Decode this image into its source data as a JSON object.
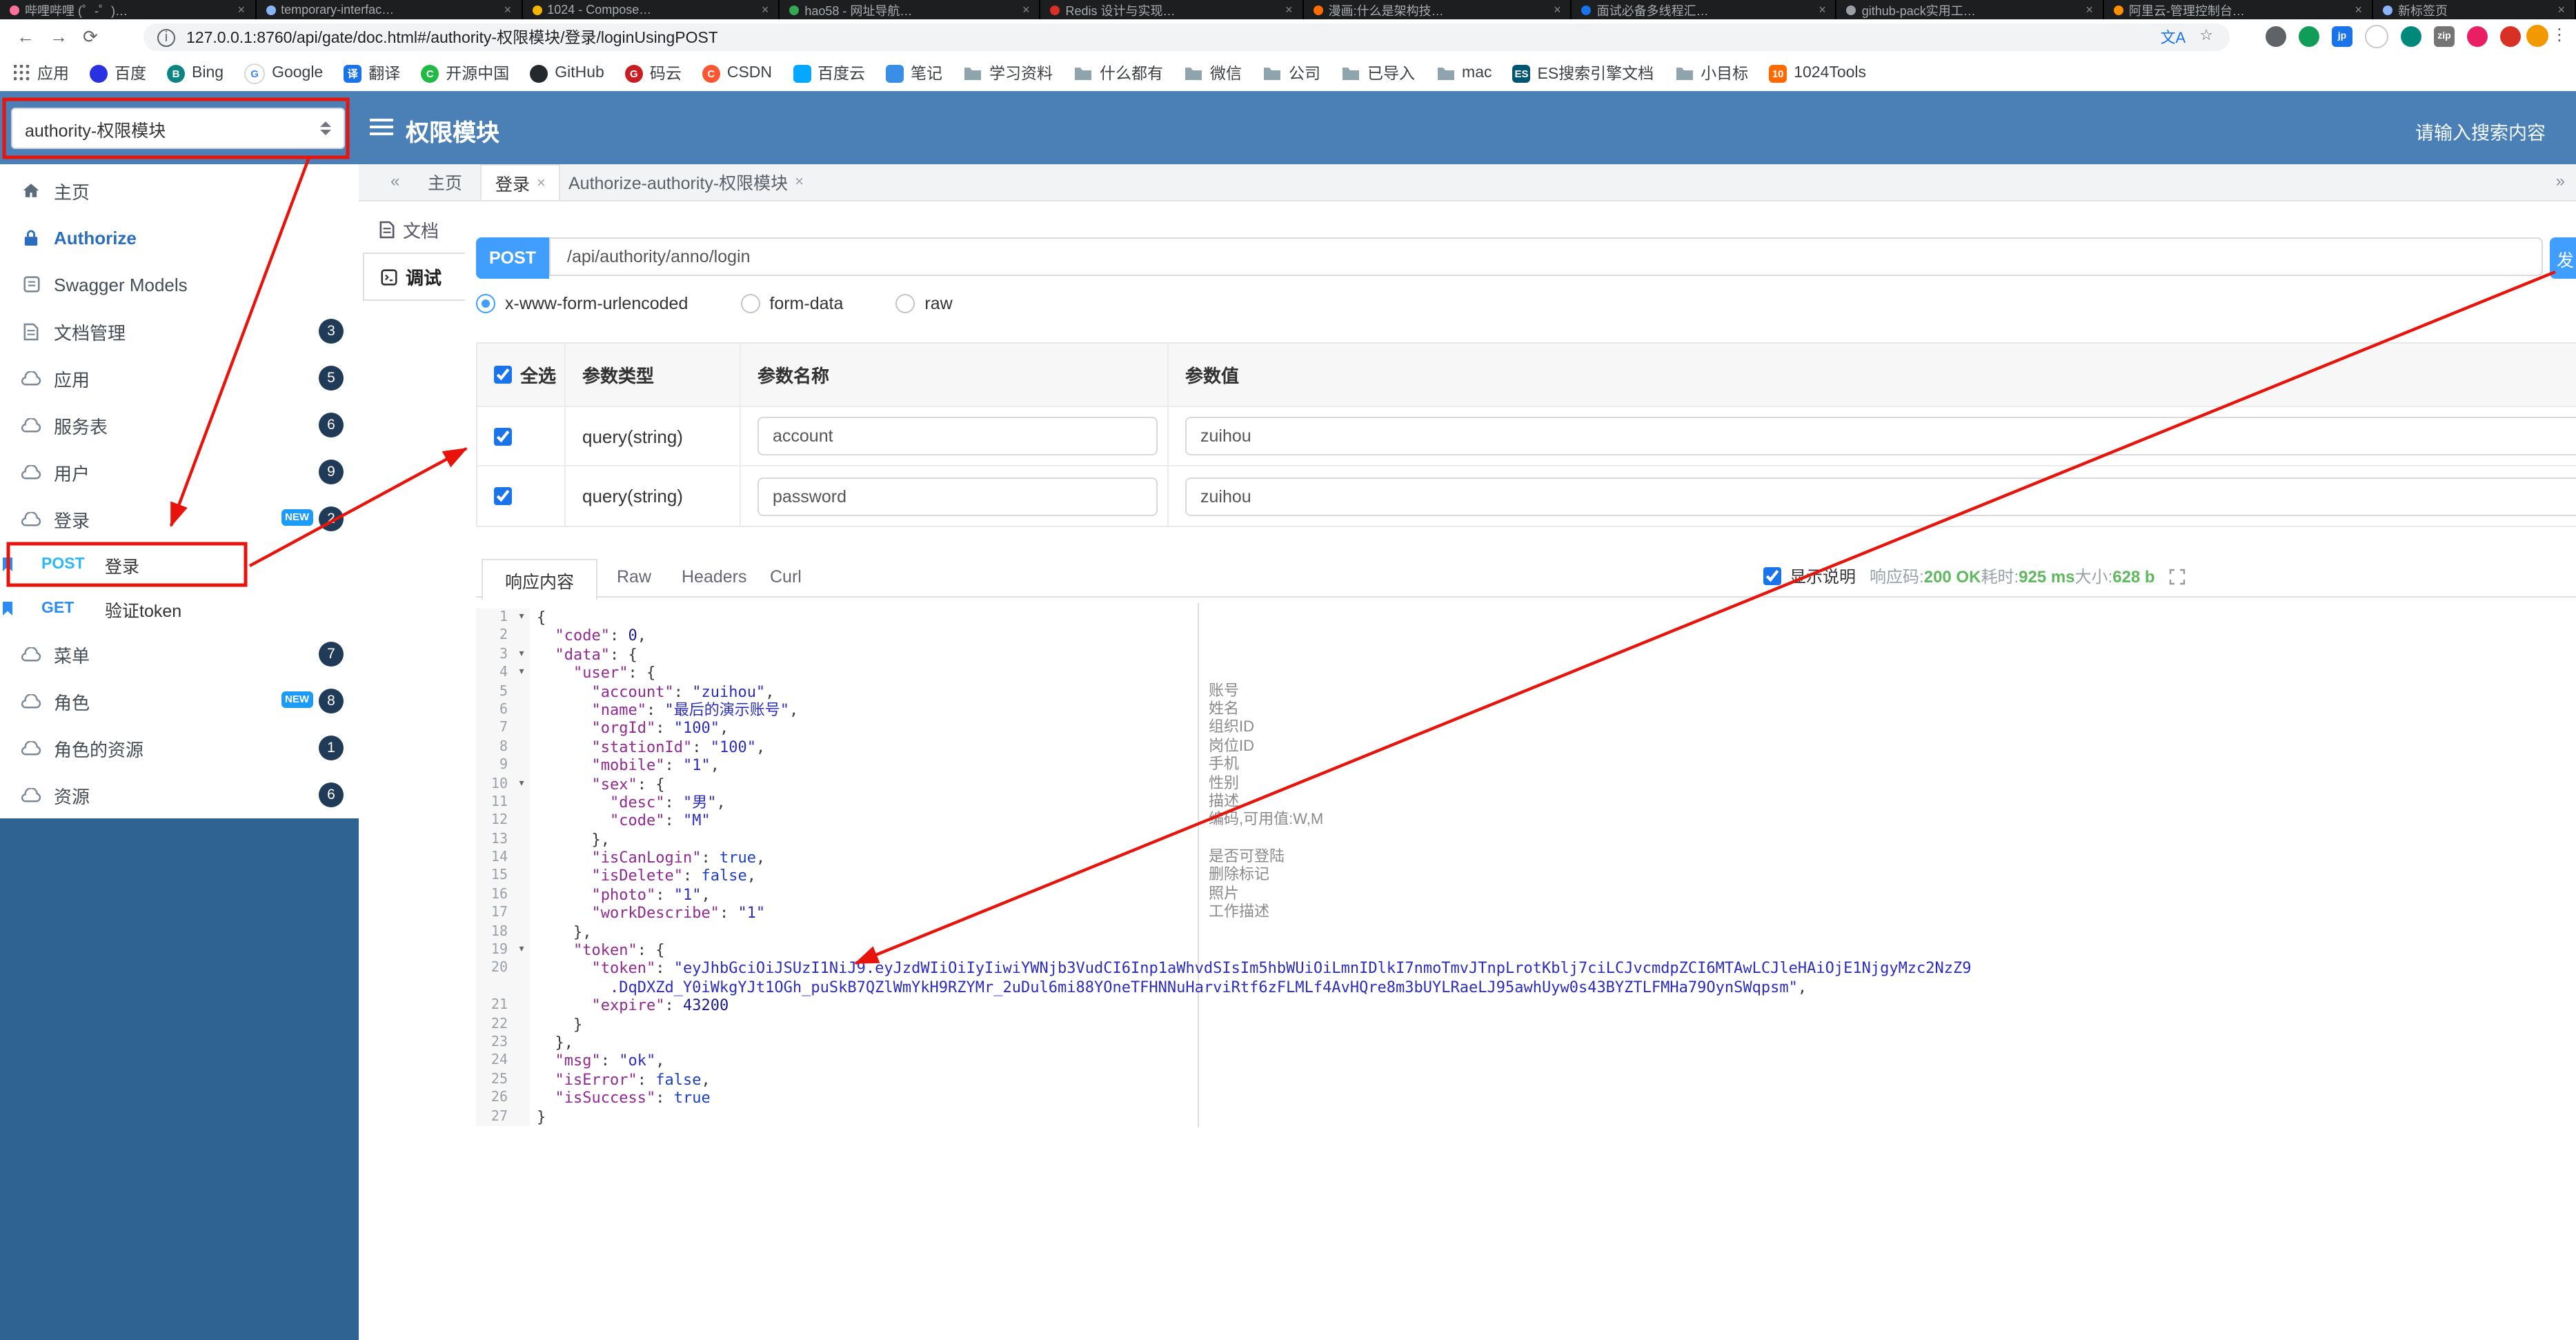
{
  "colors": {
    "accent": "#409EFF",
    "header_blue": "#4b80b6",
    "sidebar_bottom_blue": "#2f6391",
    "annotation_red": "#e8140c",
    "success_green": "#5eb95e",
    "post_method": "#2db7f5",
    "get_method": "#2d8cf0",
    "badge": "#1f3b57",
    "new_badge": "#1c9cf6"
  },
  "browser": {
    "tabs": [
      {
        "title": "哔哩哔哩 (゜-゜)…",
        "color": "#fb7299"
      },
      {
        "title": "temporary-interfac…",
        "color": "#8ab4f8"
      },
      {
        "title": "1024 - Compose…",
        "color": "#f4b400"
      },
      {
        "title": "hao58 - 网址导航…",
        "color": "#34a853"
      },
      {
        "title": "Redis 设计与实现…",
        "color": "#d93025"
      },
      {
        "title": "漫画:什么是架构技…",
        "color": "#ff6d00"
      },
      {
        "title": "面试必备多线程汇…",
        "color": "#1a73e8"
      },
      {
        "title": "github-pack实用工…",
        "color": "#9aa0a6"
      },
      {
        "title": "阿里云-管理控制台…",
        "color": "#ff8f00"
      },
      {
        "title": "新标签页",
        "color": "#8ab4f8"
      }
    ],
    "url": "127.0.0.1:8760/api/gate/doc.html#/authority-权限模块/登录/loginUsingPOST",
    "extensions": [
      {
        "shape": "circle",
        "color": "#5f6368",
        "letter": ""
      },
      {
        "shape": "circle",
        "color": "#0f9d58",
        "letter": ""
      },
      {
        "shape": "square",
        "color": "#1a73e8",
        "letter": "jp"
      },
      {
        "shape": "circle",
        "color": "#ffffff",
        "letter": "",
        "border": true
      },
      {
        "shape": "circle",
        "color": "#00897b",
        "letter": ""
      },
      {
        "shape": "square",
        "color": "#757575",
        "letter": "zip"
      },
      {
        "shape": "circle",
        "color": "#e91e63",
        "letter": ""
      },
      {
        "shape": "circle",
        "color": "#d93025",
        "letter": ""
      }
    ],
    "bookmarks": [
      {
        "label": "应用",
        "icon": "apps"
      },
      {
        "label": "百度",
        "icon": "circle",
        "color": "#2932e1",
        "letter": ""
      },
      {
        "label": "Bing",
        "icon": "circle",
        "color": "#0c8484",
        "letter": "B"
      },
      {
        "label": "Google",
        "icon": "circle",
        "color": "#ffffff",
        "letter": "G",
        "fg": "#4285f4",
        "border": true
      },
      {
        "label": "翻译",
        "icon": "square",
        "color": "#1a73e8",
        "letter": "译"
      },
      {
        "label": "开源中国",
        "icon": "circle",
        "color": "#21ba45",
        "letter": "C"
      },
      {
        "label": "GitHub",
        "icon": "circle",
        "color": "#24292e",
        "letter": ""
      },
      {
        "label": "码云",
        "icon": "circle",
        "color": "#c71d23",
        "letter": "G"
      },
      {
        "label": "CSDN",
        "icon": "circle",
        "color": "#fc5531",
        "letter": "C"
      },
      {
        "label": "百度云",
        "icon": "square",
        "color": "#06a7ff",
        "letter": ""
      },
      {
        "label": "笔记",
        "icon": "square",
        "color": "#3a8ee6",
        "letter": ""
      },
      {
        "label": "学习资料",
        "icon": "folder"
      },
      {
        "label": "什么都有",
        "icon": "folder"
      },
      {
        "label": "微信",
        "icon": "folder"
      },
      {
        "label": "公司",
        "icon": "folder"
      },
      {
        "label": "已导入",
        "icon": "folder"
      },
      {
        "label": "mac",
        "icon": "folder"
      },
      {
        "label": "ES搜索引擎文档",
        "icon": "square",
        "color": "#005571",
        "letter": "ES"
      },
      {
        "label": "小目标",
        "icon": "folder"
      },
      {
        "label": "1024Tools",
        "icon": "square",
        "color": "#ff6a00",
        "letter": "10"
      }
    ]
  },
  "header": {
    "module_select": "authority-权限模块",
    "title": "权限模块",
    "search_placeholder": "请输入搜索内容"
  },
  "sidebar": {
    "items": [
      {
        "name": "home",
        "label": "主页",
        "icon": "home"
      },
      {
        "name": "authorize",
        "label": "Authorize",
        "icon": "lock"
      },
      {
        "name": "swagger-models",
        "label": "Swagger Models",
        "icon": "model"
      },
      {
        "name": "doc-manage",
        "label": "文档管理",
        "icon": "doc",
        "badge": "3"
      },
      {
        "name": "app",
        "label": "应用",
        "icon": "cloud",
        "badge": "5"
      },
      {
        "name": "service",
        "label": "服务表",
        "icon": "cloud",
        "badge": "6"
      },
      {
        "name": "user",
        "label": "用户",
        "icon": "cloud",
        "badge": "9"
      },
      {
        "name": "login",
        "label": "登录",
        "icon": "cloud",
        "badge": "2",
        "new_flag": true
      },
      {
        "name": "menu",
        "label": "菜单",
        "icon": "cloud",
        "badge": "7"
      },
      {
        "name": "role",
        "label": "角色",
        "icon": "cloud",
        "badge": "8",
        "new_flag": true
      },
      {
        "name": "role-resource",
        "label": "角色的资源",
        "icon": "cloud",
        "badge": "1"
      },
      {
        "name": "resource",
        "label": "资源",
        "icon": "cloud",
        "badge": "6"
      }
    ],
    "sub_items": [
      {
        "method": "POST",
        "label": "登录"
      },
      {
        "method": "GET",
        "label": "验证token"
      }
    ]
  },
  "doc_tabs": {
    "collapse": "«",
    "expand": "»",
    "tabs": [
      {
        "label": "主页"
      },
      {
        "label": "登录",
        "close": "×"
      },
      {
        "label": "Authorize-authority-权限模块",
        "close": "×"
      }
    ]
  },
  "side_tabs": [
    {
      "label": "文档"
    },
    {
      "label": "调试"
    }
  ],
  "request": {
    "method": "POST",
    "path": "/api/authority/anno/login",
    "send_label": "发",
    "body_types": [
      {
        "label": "x-www-form-urlencoded",
        "selected": true
      },
      {
        "label": "form-data"
      },
      {
        "label": "raw"
      }
    ],
    "params_table": {
      "headers": {
        "select_all": "全选",
        "type": "参数类型",
        "name": "参数名称",
        "value": "参数值"
      },
      "rows": [
        {
          "checked": true,
          "type": "query(string)",
          "name": "account",
          "value": "zuihou"
        },
        {
          "checked": true,
          "type": "query(string)",
          "name": "password",
          "value": "zuihou"
        }
      ]
    }
  },
  "response": {
    "tabs": [
      {
        "label": "响应内容",
        "active": true
      },
      {
        "label": "Raw"
      },
      {
        "label": "Headers"
      },
      {
        "label": "Curl"
      }
    ],
    "show_desc_label": "显示说明",
    "meta": [
      {
        "label": "响应码:",
        "value": "200 OK"
      },
      {
        "label": "耗时:",
        "value": "925 ms"
      },
      {
        "label": "大小:",
        "value": "628 b"
      }
    ],
    "code_lines": [
      {
        "num": 1,
        "fold": true,
        "seg": [
          [
            "p",
            "{"
          ]
        ],
        "desc": ""
      },
      {
        "num": 2,
        "seg": [
          [
            "p",
            "  "
          ],
          [
            "k",
            "\"code\""
          ],
          [
            "p",
            ": "
          ],
          [
            "n",
            "0"
          ],
          [
            "p",
            ","
          ]
        ]
      },
      {
        "num": 3,
        "fold": true,
        "seg": [
          [
            "p",
            "  "
          ],
          [
            "k",
            "\"data\""
          ],
          [
            "p",
            ": {"
          ]
        ]
      },
      {
        "num": 4,
        "fold": true,
        "seg": [
          [
            "p",
            "    "
          ],
          [
            "k",
            "\"user\""
          ],
          [
            "p",
            ": {"
          ]
        ]
      },
      {
        "num": 5,
        "seg": [
          [
            "p",
            "      "
          ],
          [
            "k",
            "\"account\""
          ],
          [
            "p",
            ": "
          ],
          [
            "s",
            "\"zuihou\""
          ],
          [
            "p",
            ","
          ]
        ],
        "desc": "账号"
      },
      {
        "num": 6,
        "seg": [
          [
            "p",
            "      "
          ],
          [
            "k",
            "\"name\""
          ],
          [
            "p",
            ": "
          ],
          [
            "s",
            "\"最后的演示账号\""
          ],
          [
            "p",
            ","
          ]
        ],
        "desc": "姓名"
      },
      {
        "num": 7,
        "seg": [
          [
            "p",
            "      "
          ],
          [
            "k",
            "\"orgId\""
          ],
          [
            "p",
            ": "
          ],
          [
            "s",
            "\"100\""
          ],
          [
            "p",
            ","
          ]
        ],
        "desc": "组织ID"
      },
      {
        "num": 8,
        "seg": [
          [
            "p",
            "      "
          ],
          [
            "k",
            "\"stationId\""
          ],
          [
            "p",
            ": "
          ],
          [
            "s",
            "\"100\""
          ],
          [
            "p",
            ","
          ]
        ],
        "desc": "岗位ID"
      },
      {
        "num": 9,
        "seg": [
          [
            "p",
            "      "
          ],
          [
            "k",
            "\"mobile\""
          ],
          [
            "p",
            ": "
          ],
          [
            "s",
            "\"1\""
          ],
          [
            "p",
            ","
          ]
        ],
        "desc": "手机"
      },
      {
        "num": 10,
        "fold": true,
        "seg": [
          [
            "p",
            "      "
          ],
          [
            "k",
            "\"sex\""
          ],
          [
            "p",
            ": {"
          ]
        ],
        "desc": "性别"
      },
      {
        "num": 11,
        "seg": [
          [
            "p",
            "        "
          ],
          [
            "k",
            "\"desc\""
          ],
          [
            "p",
            ": "
          ],
          [
            "s",
            "\"男\""
          ],
          [
            "p",
            ","
          ]
        ],
        "desc": "描述"
      },
      {
        "num": 12,
        "seg": [
          [
            "p",
            "        "
          ],
          [
            "k",
            "\"code\""
          ],
          [
            "p",
            ": "
          ],
          [
            "s",
            "\"M\""
          ]
        ],
        "desc": "编码,可用值:W,M"
      },
      {
        "num": 13,
        "seg": [
          [
            "p",
            "      },"
          ]
        ]
      },
      {
        "num": 14,
        "seg": [
          [
            "p",
            "      "
          ],
          [
            "k",
            "\"isCanLogin\""
          ],
          [
            "p",
            ": "
          ],
          [
            "b",
            "true"
          ],
          [
            "p",
            ","
          ]
        ],
        "desc": "是否可登陆"
      },
      {
        "num": 15,
        "seg": [
          [
            "p",
            "      "
          ],
          [
            "k",
            "\"isDelete\""
          ],
          [
            "p",
            ": "
          ],
          [
            "b",
            "false"
          ],
          [
            "p",
            ","
          ]
        ],
        "desc": "删除标记"
      },
      {
        "num": 16,
        "seg": [
          [
            "p",
            "      "
          ],
          [
            "k",
            "\"photo\""
          ],
          [
            "p",
            ": "
          ],
          [
            "s",
            "\"1\""
          ],
          [
            "p",
            ","
          ]
        ],
        "desc": "照片"
      },
      {
        "num": 17,
        "seg": [
          [
            "p",
            "      "
          ],
          [
            "k",
            "\"workDescribe\""
          ],
          [
            "p",
            ": "
          ],
          [
            "s",
            "\"1\""
          ]
        ],
        "desc": "工作描述"
      },
      {
        "num": 18,
        "seg": [
          [
            "p",
            "    },"
          ]
        ]
      },
      {
        "num": 19,
        "fold": true,
        "seg": [
          [
            "p",
            "    "
          ],
          [
            "k",
            "\"token\""
          ],
          [
            "p",
            ": {"
          ]
        ]
      },
      {
        "num": 20,
        "seg": [
          [
            "p",
            "      "
          ],
          [
            "k",
            "\"token\""
          ],
          [
            "p",
            ": "
          ],
          [
            "s",
            "\"eyJhbGciOiJSUzI1NiJ9.eyJzdWIiOiIyIiwiYWNjb3VudCI6Inp1aWhvdSIsIm5hbWUiOiLmnIDlkI7nmoTmvJTnpLrotKblj7ciLCJvcmdpZCI6MTAwLCJleHAiOjE1NjgyMzc2NzZ9"
          ]
        ]
      },
      {
        "num": null,
        "seg": [
          [
            "p",
            "        "
          ],
          [
            "s",
            ".DqDXZd_Y0iWkgYJt1OGh_puSkB7QZlWmYkH9RZYMr_2uDul6mi88YOneTFHNNuHarviRtf6zFLMLf4AvHQre8m3bUYLRaeLJ95awhUyw0s43BYZTLFMHa79OynSWqpsm\""
          ],
          [
            "p",
            ","
          ]
        ]
      },
      {
        "num": 21,
        "seg": [
          [
            "p",
            "      "
          ],
          [
            "k",
            "\"expire\""
          ],
          [
            "p",
            ": "
          ],
          [
            "n",
            "43200"
          ]
        ]
      },
      {
        "num": 22,
        "seg": [
          [
            "p",
            "    }"
          ]
        ]
      },
      {
        "num": 23,
        "seg": [
          [
            "p",
            "  },"
          ]
        ]
      },
      {
        "num": 24,
        "seg": [
          [
            "p",
            "  "
          ],
          [
            "k",
            "\"msg\""
          ],
          [
            "p",
            ": "
          ],
          [
            "s",
            "\"ok\""
          ],
          [
            "p",
            ","
          ]
        ]
      },
      {
        "num": 25,
        "seg": [
          [
            "p",
            "  "
          ],
          [
            "k",
            "\"isError\""
          ],
          [
            "p",
            ": "
          ],
          [
            "b",
            "false"
          ],
          [
            "p",
            ","
          ]
        ]
      },
      {
        "num": 26,
        "seg": [
          [
            "p",
            "  "
          ],
          [
            "k",
            "\"isSuccess\""
          ],
          [
            "p",
            ": "
          ],
          [
            "b",
            "true"
          ]
        ]
      },
      {
        "num": 27,
        "seg": [
          [
            "p",
            "}"
          ]
        ]
      }
    ]
  }
}
